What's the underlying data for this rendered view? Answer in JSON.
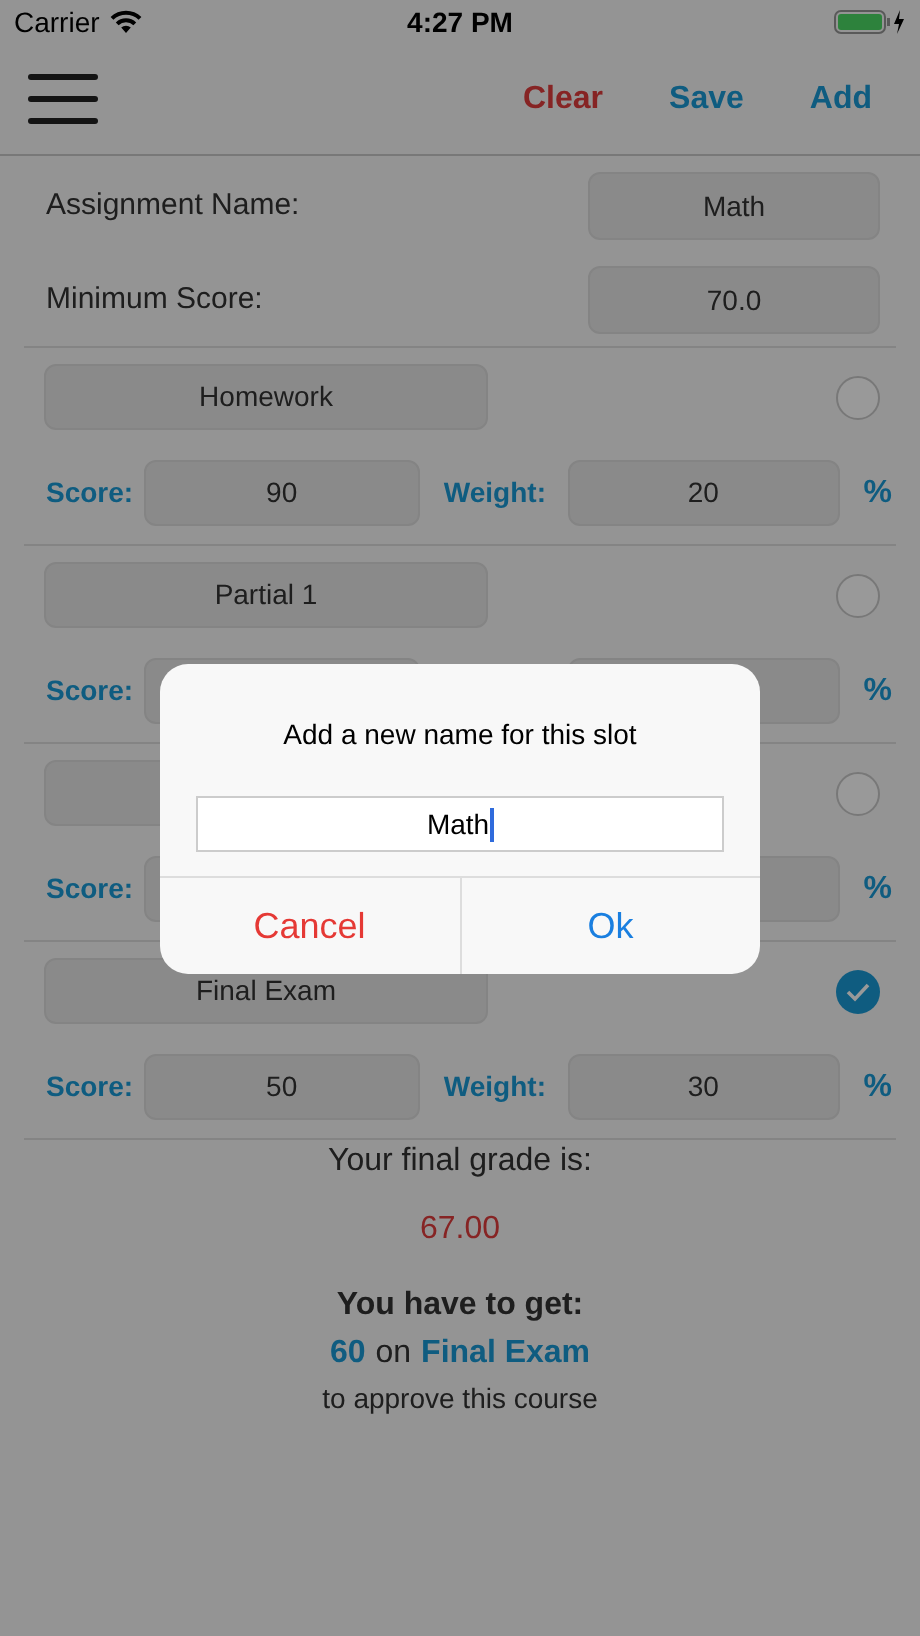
{
  "status_bar": {
    "carrier": "Carrier",
    "time": "4:27 PM"
  },
  "nav": {
    "actions": [
      {
        "label": "Clear",
        "kind": "destructive"
      },
      {
        "label": "Save",
        "kind": "normal"
      },
      {
        "label": "Add",
        "kind": "normal"
      }
    ]
  },
  "assignment": {
    "fields": [
      {
        "label": "Assignment Name:",
        "value": "Math"
      },
      {
        "label": "Minimum Score:",
        "value": "70.0"
      }
    ]
  },
  "slots": [
    {
      "name": "Homework",
      "selected": false,
      "score_label": "Score:",
      "score": "90",
      "weight_label": "Weight:",
      "weight": "20",
      "percent": "%"
    },
    {
      "name": "Partial 1",
      "selected": false,
      "score_label": "Score:",
      "percent": "%"
    },
    {
      "selected": false,
      "score_label": "Score:",
      "percent": "%"
    },
    {
      "name": "Final Exam",
      "selected": true,
      "score_label": "Score:",
      "score": "50",
      "weight_label": "Weight:",
      "weight": "30",
      "percent": "%"
    }
  ],
  "result": {
    "heading": "Your final grade is:",
    "grade": "67.00",
    "requirement": "You have to get:",
    "needed": "60",
    "connector": "on",
    "target": "Final Exam",
    "footer": "to approve this course"
  },
  "dialog": {
    "title": "Add a new name for this slot",
    "value": "Math",
    "buttons": [
      {
        "label": "Cancel",
        "kind": "cancel"
      },
      {
        "label": "Ok",
        "kind": "default"
      }
    ]
  }
}
